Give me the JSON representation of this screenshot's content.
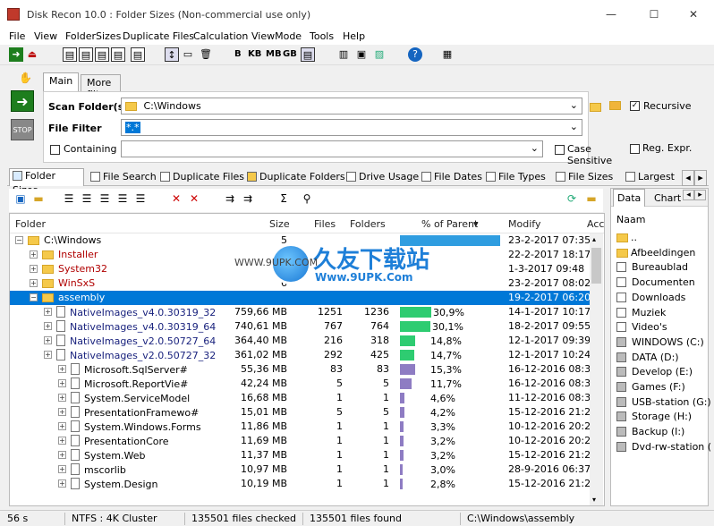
{
  "window": {
    "title": "Disk Recon 10.0 : Folder Sizes  (Non-commercial use only)",
    "min": "—",
    "max": "☐",
    "close": "✕"
  },
  "menu": [
    "File",
    "View",
    "FolderSizes",
    "Duplicate Files",
    "Calculation",
    "ViewMode",
    "Tools",
    "Help"
  ],
  "toolbar": {
    "units": [
      "B",
      "KB",
      "MB",
      "GB"
    ]
  },
  "top_tabs": [
    "Main",
    "More filters"
  ],
  "main": {
    "scan_label": "Scan Folder(s)",
    "scan_value": "C:\\Windows",
    "recursive_label": "Recursive",
    "filter_label": "File Filter",
    "filter_value": "*.*",
    "containing_label": "Containing",
    "case_label": "Case Sensitive",
    "regex_label": "Reg. Expr."
  },
  "left_buttons": {
    "go": "➜",
    "stop": "STOP"
  },
  "view_tabs": [
    "Folder Sizes",
    "File Search",
    "Duplicate Files",
    "Duplicate Folders",
    "Drive Usage",
    "File Dates",
    "File Types",
    "File Sizes",
    "Largest File"
  ],
  "columns": {
    "folder": "Folder",
    "size": "Size",
    "files": "Files",
    "folders": "Folders",
    "pct": "% of Parent",
    "modify": "Modify",
    "access": "Acce"
  },
  "rows": [
    {
      "name": "C:\\Windows",
      "size": "5",
      "files": "",
      "folders": "",
      "pct": "",
      "pctv": 100,
      "mod": "23-2-2017 07:35",
      "level": 0,
      "icon": "folder",
      "color": "#000",
      "exp": "−",
      "barcolor": "#2f9de0"
    },
    {
      "name": "Installer",
      "size": "3",
      "files": "",
      "folders": "",
      "pct": "",
      "pctv": 0,
      "mod": "22-2-2017 18:17",
      "level": 1,
      "icon": "folder",
      "color": "#b00000",
      "exp": "+",
      "barcolor": "#2f9de0"
    },
    {
      "name": "System32",
      "size": "",
      "files": "",
      "folders": "",
      "pct": "",
      "pctv": 0,
      "mod": "1-3-2017 09:48",
      "level": 1,
      "icon": "folder",
      "color": "#b00000",
      "exp": "+",
      "barcolor": "#2f9de0"
    },
    {
      "name": "WinSxS",
      "size": "6",
      "files": "",
      "folders": "",
      "pct": "",
      "pctv": 0,
      "mod": "23-2-2017 08:02",
      "level": 1,
      "icon": "folder",
      "color": "#b00000",
      "exp": "+",
      "barcolor": "#2f9de0"
    },
    {
      "name": "assembly",
      "size": "",
      "files": "",
      "folders": "",
      "pct": "",
      "pctv": 0,
      "mod": "19-2-2017 06:20",
      "level": 1,
      "icon": "folder",
      "color": "#fff",
      "exp": "−",
      "barcolor": "#2f9de0",
      "selected": true
    },
    {
      "name": "NativeImages_v4.0.30319_32",
      "size": "759,66 MB",
      "files": "1251",
      "folders": "1236",
      "pct": "30,9%",
      "pctv": 30.9,
      "mod": "14-1-2017 10:17",
      "level": 2,
      "icon": "doc",
      "color": "#1a237e",
      "exp": "+",
      "barcolor": "#2ecc71"
    },
    {
      "name": "NativeImages_v4.0.30319_64",
      "size": "740,61 MB",
      "files": "767",
      "folders": "764",
      "pct": "30,1%",
      "pctv": 30.1,
      "mod": "18-2-2017 09:55",
      "level": 2,
      "icon": "doc",
      "color": "#1a237e",
      "exp": "+",
      "barcolor": "#2ecc71"
    },
    {
      "name": "NativeImages_v2.0.50727_64",
      "size": "364,40 MB",
      "files": "216",
      "folders": "318",
      "pct": "14,8%",
      "pctv": 14.8,
      "mod": "12-1-2017 09:39",
      "level": 2,
      "icon": "doc",
      "color": "#1a237e",
      "exp": "+",
      "barcolor": "#2ecc71"
    },
    {
      "name": "NativeImages_v2.0.50727_32",
      "size": "361,02 MB",
      "files": "292",
      "folders": "425",
      "pct": "14,7%",
      "pctv": 14.7,
      "mod": "12-1-2017 10:24",
      "level": 2,
      "icon": "doc",
      "color": "#1a237e",
      "exp": "+",
      "barcolor": "#2ecc71"
    },
    {
      "name": "Microsoft.SqlServer#",
      "size": "55,36 MB",
      "files": "83",
      "folders": "83",
      "pct": "15,3%",
      "pctv": 15.3,
      "mod": "16-12-2016 08:35",
      "level": 3,
      "icon": "doc",
      "color": "#000",
      "exp": "+",
      "barcolor": "#8e7cc3"
    },
    {
      "name": "Microsoft.ReportVie#",
      "size": "42,24 MB",
      "files": "5",
      "folders": "5",
      "pct": "11,7%",
      "pctv": 11.7,
      "mod": "16-12-2016 08:34",
      "level": 3,
      "icon": "doc",
      "color": "#000",
      "exp": "+",
      "barcolor": "#8e7cc3"
    },
    {
      "name": "System.ServiceModel",
      "size": "16,68 MB",
      "files": "1",
      "folders": "1",
      "pct": "4,6%",
      "pctv": 4.6,
      "mod": "11-12-2016 08:38",
      "level": 3,
      "icon": "doc",
      "color": "#000",
      "exp": "+",
      "barcolor": "#8e7cc3"
    },
    {
      "name": "PresentationFramewo#",
      "size": "15,01 MB",
      "files": "5",
      "folders": "5",
      "pct": "4,2%",
      "pctv": 4.2,
      "mod": "15-12-2016 21:22",
      "level": 3,
      "icon": "doc",
      "color": "#000",
      "exp": "+",
      "barcolor": "#8e7cc3"
    },
    {
      "name": "System.Windows.Forms",
      "size": "11,86 MB",
      "files": "1",
      "folders": "1",
      "pct": "3,3%",
      "pctv": 3.3,
      "mod": "10-12-2016 20:21",
      "level": 3,
      "icon": "doc",
      "color": "#000",
      "exp": "+",
      "barcolor": "#8e7cc3"
    },
    {
      "name": "PresentationCore",
      "size": "11,69 MB",
      "files": "1",
      "folders": "1",
      "pct": "3,2%",
      "pctv": 3.2,
      "mod": "10-12-2016 20:21",
      "level": 3,
      "icon": "doc",
      "color": "#000",
      "exp": "+",
      "barcolor": "#8e7cc3"
    },
    {
      "name": "System.Web",
      "size": "11,37 MB",
      "files": "1",
      "folders": "1",
      "pct": "3,2%",
      "pctv": 3.2,
      "mod": "15-12-2016 21:22",
      "level": 3,
      "icon": "doc",
      "color": "#000",
      "exp": "+",
      "barcolor": "#8e7cc3"
    },
    {
      "name": "mscorlib",
      "size": "10,97 MB",
      "files": "1",
      "folders": "1",
      "pct": "3,0%",
      "pctv": 3.0,
      "mod": "28-9-2016 06:37",
      "level": 3,
      "icon": "doc",
      "color": "#000",
      "exp": "+",
      "barcolor": "#8e7cc3"
    },
    {
      "name": "System.Design",
      "size": "10,19 MB",
      "files": "1",
      "folders": "1",
      "pct": "2,8%",
      "pctv": 2.8,
      "mod": "15-12-2016 21:22",
      "level": 3,
      "icon": "doc",
      "color": "#000",
      "exp": "+",
      "barcolor": "#8e7cc3"
    }
  ],
  "right_panel": {
    "tabs": [
      "Data",
      "Chart"
    ],
    "header": "Naam",
    "items": [
      "..",
      "Afbeeldingen",
      "Bureaublad",
      "Documenten",
      "Downloads",
      "Muziek",
      "Video's",
      "WINDOWS (C:)",
      "DATA (D:)",
      "Develop (E:)",
      "Games (F:)",
      "USB-station (G:)",
      "Storage (H:)",
      "Backup (I:)",
      "Dvd-rw-station ("
    ]
  },
  "status": {
    "time": "56 s",
    "fs": "NTFS : 4K Cluster",
    "checked": "135501 files checked",
    "found": "135501 files found",
    "path": "C:\\Windows\\assembly"
  },
  "watermark": {
    "text": "久友下载站",
    "url": "Www.9UPK.Com",
    "side": "WWW.9UPK.COM"
  }
}
